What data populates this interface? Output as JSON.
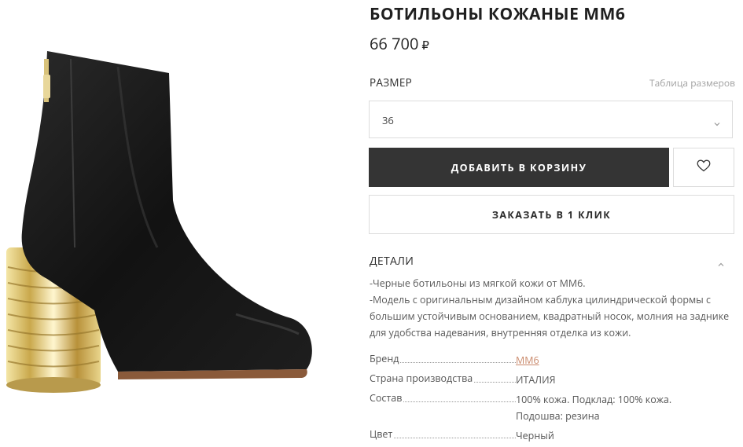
{
  "product": {
    "title": "БОТИЛЬОНЫ КОЖАНЫЕ MM6",
    "price": "66 700",
    "currency": "₽"
  },
  "size": {
    "label": "РАЗМЕР",
    "chart_link": "Таблица размеров",
    "selected": "36"
  },
  "actions": {
    "add_to_cart": "ДОБАВИТЬ В КОРЗИНУ",
    "one_click": "ЗАКАЗАТЬ В 1 КЛИК",
    "wishlist_icon": "heart-icon"
  },
  "details": {
    "heading": "ДЕТАЛИ",
    "description": [
      "-Черные ботильоны из мягкой кожи от MM6.",
      "-Модель с оригинальным дизайном каблука цилиндрической формы с большим устойчивым основанием, квадратный носок, молния на заднике для удобства надевания, внутренняя отделка из кожи."
    ],
    "properties": [
      {
        "key": "Бренд",
        "value": "MM6"
      },
      {
        "key": "Страна производства",
        "value": "ИТАЛИЯ"
      },
      {
        "key": "Состав",
        "value": "100% кожа. Подклад: 100% кожа.",
        "value2": "Подошва: резина"
      },
      {
        "key": "Цвет",
        "value": "Черный"
      }
    ]
  }
}
